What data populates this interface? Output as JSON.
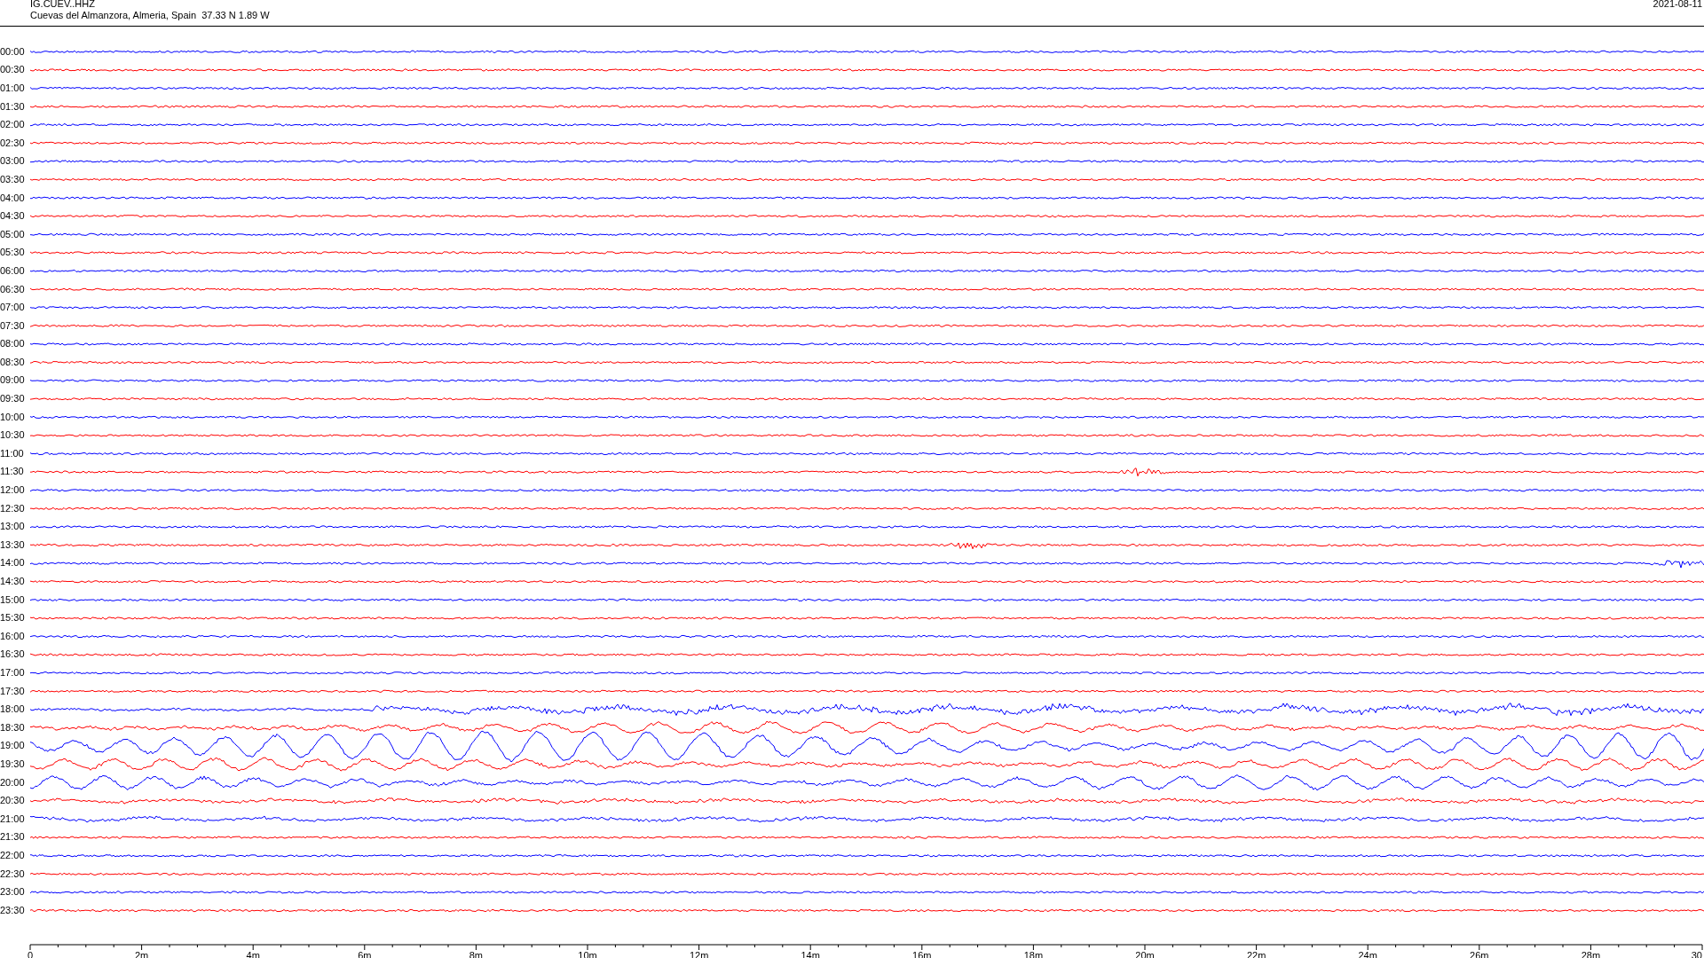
{
  "header": {
    "station": "IG.CUEV..HHZ",
    "location": "Cuevas del Almanzora, Almeria, Spain  37.33 N 1.89 W",
    "date": "2021-08-11"
  },
  "rows": [
    {
      "label": "00:00",
      "color": "#0000ff",
      "kind": "quiet"
    },
    {
      "label": "00:30",
      "color": "#ff0000",
      "kind": "quiet"
    },
    {
      "label": "01:00",
      "color": "#0000ff",
      "kind": "quiet"
    },
    {
      "label": "01:30",
      "color": "#ff0000",
      "kind": "quiet"
    },
    {
      "label": "02:00",
      "color": "#0000ff",
      "kind": "quiet"
    },
    {
      "label": "02:30",
      "color": "#ff0000",
      "kind": "quiet"
    },
    {
      "label": "03:00",
      "color": "#0000ff",
      "kind": "quiet"
    },
    {
      "label": "03:30",
      "color": "#ff0000",
      "kind": "quiet"
    },
    {
      "label": "04:00",
      "color": "#0000ff",
      "kind": "quiet"
    },
    {
      "label": "04:30",
      "color": "#ff0000",
      "kind": "quiet"
    },
    {
      "label": "05:00",
      "color": "#0000ff",
      "kind": "quiet"
    },
    {
      "label": "05:30",
      "color": "#ff0000",
      "kind": "quiet"
    },
    {
      "label": "06:00",
      "color": "#0000ff",
      "kind": "quiet"
    },
    {
      "label": "06:30",
      "color": "#ff0000",
      "kind": "quiet"
    },
    {
      "label": "07:00",
      "color": "#0000ff",
      "kind": "quiet"
    },
    {
      "label": "07:30",
      "color": "#ff0000",
      "kind": "quiet"
    },
    {
      "label": "08:00",
      "color": "#0000ff",
      "kind": "quiet"
    },
    {
      "label": "08:30",
      "color": "#ff0000",
      "kind": "quiet"
    },
    {
      "label": "09:00",
      "color": "#0000ff",
      "kind": "quiet"
    },
    {
      "label": "09:30",
      "color": "#ff0000",
      "kind": "quiet"
    },
    {
      "label": "10:00",
      "color": "#0000ff",
      "kind": "quiet"
    },
    {
      "label": "10:30",
      "color": "#ff0000",
      "kind": "quiet"
    },
    {
      "label": "11:00",
      "color": "#0000ff",
      "kind": "quiet"
    },
    {
      "label": "11:30",
      "color": "#ff0000",
      "kind": "burst"
    },
    {
      "label": "12:00",
      "color": "#0000ff",
      "kind": "quiet"
    },
    {
      "label": "12:30",
      "color": "#ff0000",
      "kind": "quiet"
    },
    {
      "label": "13:00",
      "color": "#0000ff",
      "kind": "quiet"
    },
    {
      "label": "13:30",
      "color": "#ff0000",
      "kind": "burst"
    },
    {
      "label": "14:00",
      "color": "#0000ff",
      "kind": "burst"
    },
    {
      "label": "14:30",
      "color": "#ff0000",
      "kind": "quiet"
    },
    {
      "label": "15:00",
      "color": "#0000ff",
      "kind": "quiet"
    },
    {
      "label": "15:30",
      "color": "#ff0000",
      "kind": "quiet"
    },
    {
      "label": "16:00",
      "color": "#0000ff",
      "kind": "quiet"
    },
    {
      "label": "16:30",
      "color": "#ff0000",
      "kind": "quiet"
    },
    {
      "label": "17:00",
      "color": "#0000ff",
      "kind": "quiet"
    },
    {
      "label": "17:30",
      "color": "#ff0000",
      "kind": "quiet"
    },
    {
      "label": "18:00",
      "color": "#0000ff",
      "kind": "swell"
    },
    {
      "label": "18:30",
      "color": "#ff0000",
      "kind": "strong"
    },
    {
      "label": "19:00",
      "color": "#0000ff",
      "kind": "strong"
    },
    {
      "label": "19:30",
      "color": "#ff0000",
      "kind": "strong"
    },
    {
      "label": "20:00",
      "color": "#0000ff",
      "kind": "strong"
    },
    {
      "label": "20:30",
      "color": "#ff0000",
      "kind": "swell"
    },
    {
      "label": "21:00",
      "color": "#0000ff",
      "kind": "swell"
    },
    {
      "label": "21:30",
      "color": "#ff0000",
      "kind": "quiet"
    },
    {
      "label": "22:00",
      "color": "#0000ff",
      "kind": "quiet"
    },
    {
      "label": "22:30",
      "color": "#ff0000",
      "kind": "quiet"
    },
    {
      "label": "23:00",
      "color": "#0000ff",
      "kind": "quiet"
    },
    {
      "label": "23:30",
      "color": "#ff0000",
      "kind": "quiet"
    }
  ],
  "x_axis": {
    "tick_labels": [
      "0",
      "2m",
      "4m",
      "6m",
      "8m",
      "10m",
      "12m",
      "14m",
      "16m",
      "18m",
      "20m",
      "22m",
      "24m",
      "26m",
      "28m",
      "30"
    ]
  }
}
